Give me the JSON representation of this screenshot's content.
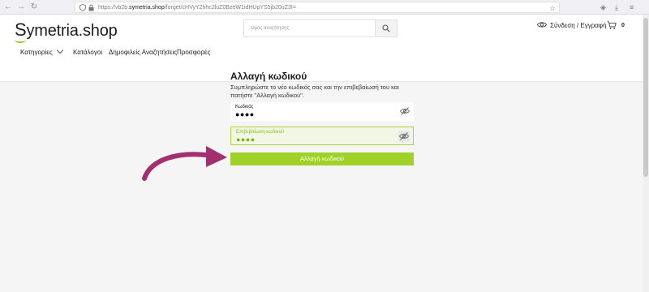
{
  "browser": {
    "url_prefix": "https://vb2b.",
    "url_domain": "symetria.shop",
    "url_path": "/forget/cHVyY2hhc2luZ0BzeW1idHUpYS5jb20uZ3I="
  },
  "header": {
    "logo_s": "S",
    "logo_rest": "ymetria.shop",
    "search_placeholder": "Όρος αναζήτησης",
    "login_label": "Σύνδεση / Εγγραφή",
    "cart_count": "0"
  },
  "menu": {
    "items": [
      "Κατηγορίες",
      "Κατάλογοι",
      "Δημοφιλείς Αναζητήσεις",
      "Προσφορές"
    ]
  },
  "form": {
    "title": "Αλλαγή κωδικού",
    "instructions": "Συμπληρώστε το νέο κωδικός σας και την επιβεβαίωσή του και πατήστε \"Αλλαγή κωδικού\".",
    "password_label": "Κωδικός",
    "password_value": "●●●●",
    "confirm_label": "Επιβεβαίωση κωδικού",
    "confirm_value": "●●●●",
    "submit_label": "Αλλαγή κωδικού"
  },
  "colors": {
    "accent_green": "#9fd129",
    "arrow_color": "#a3306e"
  }
}
